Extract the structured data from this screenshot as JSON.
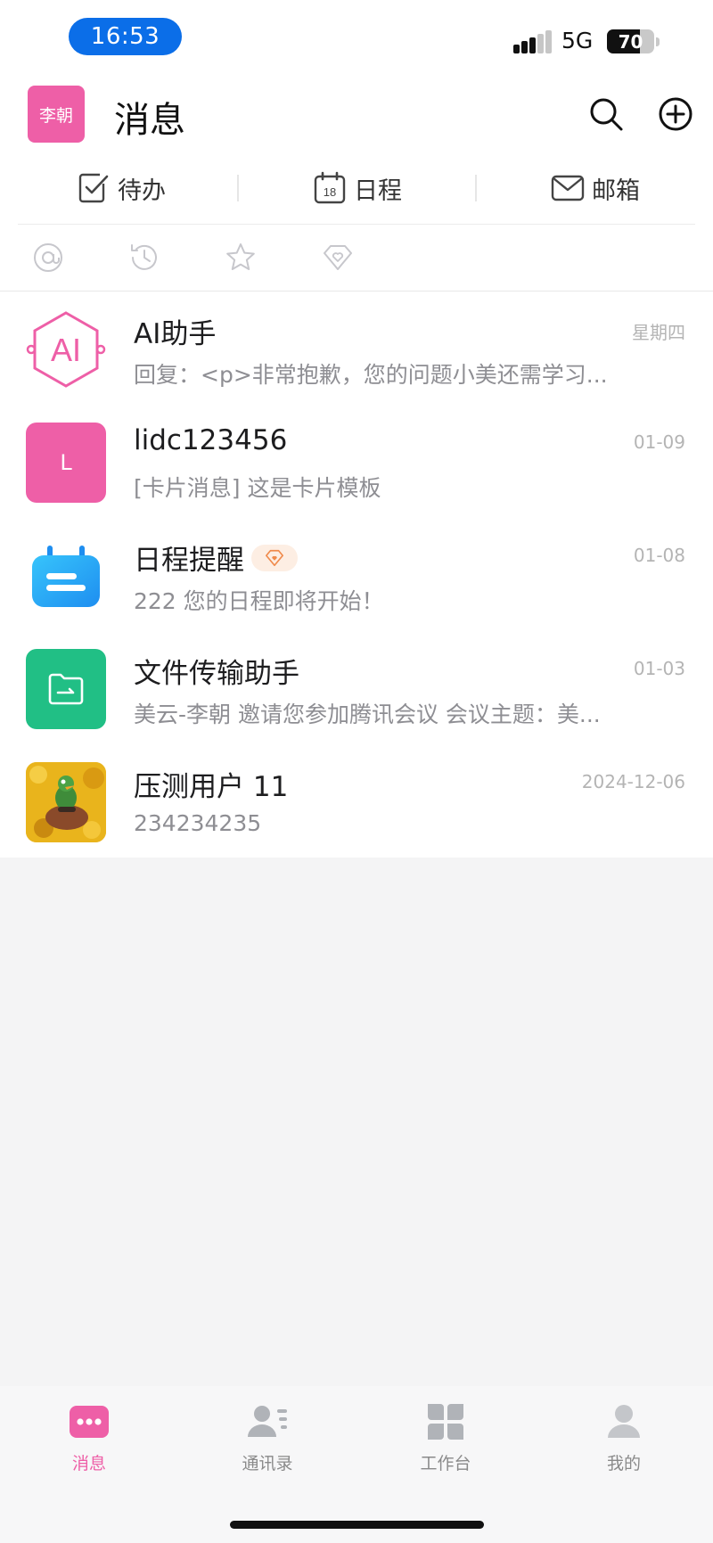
{
  "status_bar": {
    "time": "16:53",
    "network": "5G",
    "battery": "70",
    "battery_level": 0.7
  },
  "header": {
    "avatar_text": "李朝",
    "title": "消息",
    "search_icon": "search-icon",
    "add_icon": "plus-circle-icon"
  },
  "quick_links": [
    {
      "label": "待办",
      "icon": "todo-check-icon"
    },
    {
      "label": "日程",
      "icon": "calendar-icon",
      "icon_text": "18"
    },
    {
      "label": "邮箱",
      "icon": "mail-icon"
    }
  ],
  "filters": [
    {
      "icon": "at-icon"
    },
    {
      "icon": "history-icon"
    },
    {
      "icon": "star-icon"
    },
    {
      "icon": "heart-tag-icon"
    }
  ],
  "conversations": [
    {
      "name": "AI助手",
      "time": "星期四",
      "preview": "回复：<p>非常抱歉，您的问题小美还需学习...",
      "avatar": "ai-logo-icon"
    },
    {
      "name": "lidc123456",
      "time": "01-09",
      "preview": "[卡片消息] 这是卡片模板",
      "avatar_text": "L"
    },
    {
      "name": "日程提醒",
      "time": "01-08",
      "preview": "222  您的日程即将开始！",
      "avatar": "schedule-bot-icon",
      "tag_icon": "heart-tag-icon"
    },
    {
      "name": "文件传输助手",
      "time": "01-03",
      "preview": "美云-李朝 邀请您参加腾讯会议  会议主题：美...",
      "avatar": "folder-transfer-icon"
    },
    {
      "name": "压测用户 11",
      "time": "2024-12-06",
      "preview": "234234235",
      "avatar": "photo-avatar"
    }
  ],
  "tabbar": [
    {
      "label": "消息",
      "icon": "chat-bubble-icon",
      "active": true
    },
    {
      "label": "通讯录",
      "icon": "contacts-icon",
      "active": false
    },
    {
      "label": "工作台",
      "icon": "workbench-icon",
      "active": false
    },
    {
      "label": "我的",
      "icon": "profile-icon",
      "active": false
    }
  ],
  "colors": {
    "brand": "#ee5fa7",
    "status_time_bg": "#0b6ee8",
    "file_assistant": "#21bf85",
    "schedule_blue": "#2ba6f4",
    "tag_orange": "#f08a4b"
  }
}
